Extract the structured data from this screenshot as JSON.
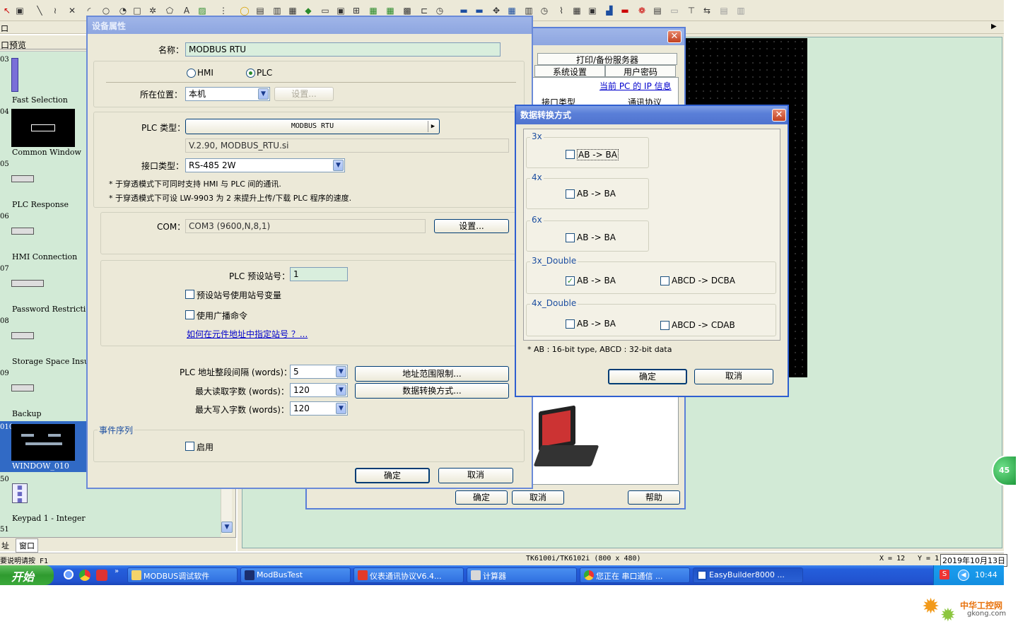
{
  "toolbar": {
    "tab_left": "口",
    "tab_right_arrow": "▶"
  },
  "preview_panel": {
    "title": "口预览",
    "items": [
      {
        "num": "03",
        "label": "Fast Selection"
      },
      {
        "num": "04",
        "label": "Common Window"
      },
      {
        "num": "05",
        "label": "PLC Response"
      },
      {
        "num": "06",
        "label": "HMI Connection"
      },
      {
        "num": "07",
        "label": "Password Restriction"
      },
      {
        "num": "08",
        "label": "Storage Space Insuffici"
      },
      {
        "num": "09",
        "label": "Backup"
      },
      {
        "num": "010",
        "label": "WINDOW_010"
      },
      {
        "num": "50",
        "label": "Keypad 1 - Integer"
      },
      {
        "num": "51",
        "label": ""
      }
    ],
    "bottom_tabs": [
      "址",
      "窗口"
    ]
  },
  "device_dialog": {
    "title": "设备属性",
    "name_label": "名称：",
    "name_value": "MODBUS RTU",
    "radio_hmi": "HMI",
    "radio_plc": "PLC",
    "location_label": "所在位置：",
    "location_value": "本机",
    "location_settings": "设置...",
    "plc_type_label": "PLC 类型：",
    "plc_type_value": "MODBUS RTU",
    "plc_version": "V.2.90, MODBUS_RTU.si",
    "interface_label": "接口类型：",
    "interface_value": "RS-485 2W",
    "note1": "* 于穿透模式下可同时支持 HMI 与 PLC 间的通讯.",
    "note2": "* 于穿透模式下可设 LW-9903 为 2 来提升上传/下载 PLC 程序的速度.",
    "com_label": "COM：",
    "com_value": "COM3 (9600,N,8,1)",
    "com_settings": "设置...",
    "station_label": "PLC 预设站号：",
    "station_value": "1",
    "station_var_label": "预设站号使用站号变量",
    "broadcast_label": "使用广播命令",
    "station_link": "如何在元件地址中指定站号 ？...",
    "interval_label": "PLC 地址整段间隔 (words)：",
    "interval_value": "5",
    "max_read_label": "最大读取字数 (words)：",
    "max_read_value": "120",
    "max_write_label": "最大写入字数 (words)：",
    "max_write_value": "120",
    "addr_limit_btn": "地址范围限制...",
    "data_conv_btn": "数据转换方式...",
    "event_group": "事件序列",
    "enable_label": "启用",
    "ok": "确定",
    "cancel": "取消"
  },
  "background_dialog": {
    "tab1": "打印/备份服务器",
    "tab2": "系统设置",
    "tab3": "用户密码",
    "ip_link": "当前 PC 的 IP 信息",
    "col1": "接口类型",
    "col2": "通讯协议",
    "ok": "确定",
    "cancel": "取消",
    "help": "帮助"
  },
  "conv_dialog": {
    "title": "数据转换方式",
    "groups": [
      {
        "name": "3x",
        "opt1": "AB -> BA",
        "opt1_checked": false
      },
      {
        "name": "4x",
        "opt1": "AB -> BA",
        "opt1_checked": false
      },
      {
        "name": "6x",
        "opt1": "AB -> BA",
        "opt1_checked": false
      },
      {
        "name": "3x_Double",
        "opt1": "AB -> BA",
        "opt1_checked": true,
        "opt2": "ABCD -> DCBA",
        "opt2_checked": false
      },
      {
        "name": "4x_Double",
        "opt1": "AB -> BA",
        "opt1_checked": false,
        "opt2": "ABCD -> CDAB",
        "opt2_checked": false
      }
    ],
    "note": "* AB : 16-bit type, ABCD : 32-bit data",
    "ok": "确定",
    "cancel": "取消"
  },
  "statusbar": {
    "help": "要说明请按 F1",
    "model": "TK6100i/TK6102i (800 x 480)",
    "x": "X = 12",
    "y": "Y = 1",
    "date": "2019年10月13日"
  },
  "taskbar": {
    "start": "开始",
    "items": [
      {
        "label": "MODBUS调试软件",
        "active": false
      },
      {
        "label": "ModBusTest",
        "active": false
      },
      {
        "label": "仪表通讯协议V6.4...",
        "active": false
      },
      {
        "label": "计算器",
        "active": false
      },
      {
        "label": "您正在 串口通信 ...",
        "active": false
      },
      {
        "label": "EasyBuilder8000 ...",
        "active": true
      }
    ],
    "clock": "10:44"
  },
  "side_badge": "45",
  "watermark": {
    "line1": "中华工控网",
    "line2": "gkong.com"
  },
  "colors": {
    "xp_blue": "#2f6fe0",
    "dialog_bg": "#ece9d8",
    "canvas_bg": "#d2ead6",
    "link": "#0000cc"
  }
}
